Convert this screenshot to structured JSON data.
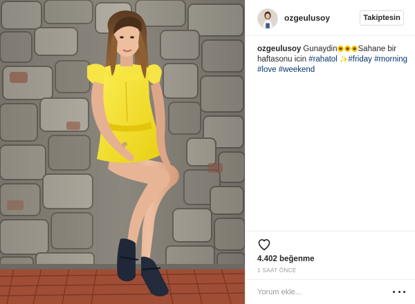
{
  "post": {
    "photo": {
      "description_icon": "post-photo"
    },
    "header": {
      "username": "ozgeulusoy",
      "follow_label": "Takiptesin",
      "avatar_icon": "avatar-photo"
    },
    "caption": {
      "username": "ozgeulusoy",
      "text_part1": "Gunaydin",
      "text_part2": "Sahane bir haftasonu icin",
      "hashtags": [
        "#rahatol",
        "#friday",
        "#morning",
        "#love",
        "#weekend"
      ],
      "emoji_icons": [
        "sunflower-icon",
        "sparkle-icon"
      ]
    },
    "actions": {
      "like_icon": "heart-icon",
      "likes": "4.402 beğenme",
      "time": "1 SAAT ÖNCE"
    },
    "comment": {
      "placeholder": "Yorum ekle...",
      "more_icon": "more-options-icon"
    }
  },
  "colors": {
    "text": "#262626",
    "hashtag": "#003569",
    "muted": "#999999",
    "border": "#efefef",
    "dress": "#f4e22a"
  }
}
